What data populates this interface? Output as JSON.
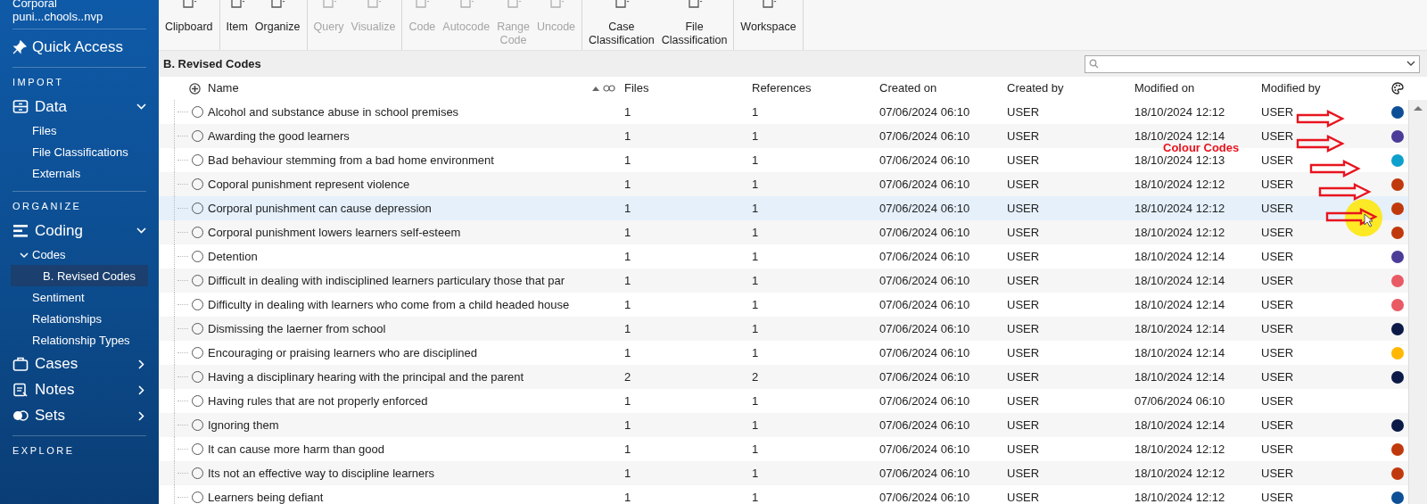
{
  "sidebar": {
    "project": [
      "Corporal",
      "puni...chools..nvp"
    ],
    "quick_access": "Quick Access",
    "sections": [
      {
        "heading": "IMPORT",
        "groups": [
          {
            "label": "Data",
            "expanded": true,
            "children": [
              {
                "label": "Files",
                "selected": false
              },
              {
                "label": "File Classifications",
                "selected": false
              },
              {
                "label": "Externals",
                "selected": false
              }
            ]
          }
        ]
      },
      {
        "heading": "ORGANIZE",
        "groups": [
          {
            "label": "Coding",
            "expanded": true,
            "children": [
              {
                "label": "Codes",
                "selected": false,
                "expanded": true,
                "children": [
                  {
                    "label": "B. Revised Codes",
                    "selected": true
                  }
                ]
              },
              {
                "label": "Sentiment",
                "selected": false
              },
              {
                "label": "Relationships",
                "selected": false
              },
              {
                "label": "Relationship Types",
                "selected": false
              }
            ]
          },
          {
            "label": "Cases",
            "expanded": false
          },
          {
            "label": "Notes",
            "expanded": false
          },
          {
            "label": "Sets",
            "expanded": false
          }
        ]
      },
      {
        "heading": "EXPLORE"
      }
    ]
  },
  "toolbar": [
    [
      {
        "label": "Clipboard",
        "disabled": false
      }
    ],
    [
      {
        "label": "Item",
        "disabled": false
      },
      {
        "label": "Organize",
        "disabled": false
      }
    ],
    [
      {
        "label": "Query",
        "disabled": true
      },
      {
        "label": "Visualize",
        "disabled": true
      }
    ],
    [
      {
        "label": "Code",
        "disabled": true
      },
      {
        "label": "Autocode",
        "disabled": true
      },
      {
        "label": "Range Code",
        "disabled": true
      },
      {
        "label": "Uncode",
        "disabled": true
      }
    ],
    [
      {
        "label": "Case Classification",
        "disabled": false
      },
      {
        "label": "File Classification",
        "disabled": false
      }
    ],
    [
      {
        "label": "Workspace",
        "disabled": false
      }
    ]
  ],
  "list_title": "B. Revised Codes",
  "table": {
    "columns": [
      {
        "label": "Name",
        "sorted": true
      },
      {
        "label": "Files"
      },
      {
        "label": "References"
      },
      {
        "label": "Created on"
      },
      {
        "label": "Created by"
      },
      {
        "label": "Modified on"
      },
      {
        "label": "Modified by"
      }
    ],
    "rows": [
      {
        "name": "Alcohol and substance abuse in school premises",
        "files": "1",
        "references": "1",
        "created_on": "07/06/2024 06:10",
        "created_by": "USER",
        "modified_on": "18/10/2024 12:12",
        "modified_by": "USER",
        "color": "#0d4f96",
        "selected": false
      },
      {
        "name": "Awarding the good learners",
        "files": "1",
        "references": "1",
        "created_on": "07/06/2024 06:10",
        "created_by": "USER",
        "modified_on": "18/10/2024 12:14",
        "modified_by": "USER",
        "color": "#4b3c98",
        "selected": false
      },
      {
        "name": "Bad behaviour stemming from a bad home environment",
        "files": "1",
        "references": "1",
        "created_on": "07/06/2024 06:10",
        "created_by": "USER",
        "modified_on": "18/10/2024 12:13",
        "modified_by": "USER",
        "color": "#0ea0cc",
        "selected": false
      },
      {
        "name": "Coporal punishment represent violence",
        "files": "1",
        "references": "1",
        "created_on": "07/06/2024 06:10",
        "created_by": "USER",
        "modified_on": "18/10/2024 12:12",
        "modified_by": "USER",
        "color": "#c0390c",
        "selected": false
      },
      {
        "name": "Corporal punishment can cause depression",
        "files": "1",
        "references": "1",
        "created_on": "07/06/2024 06:10",
        "created_by": "USER",
        "modified_on": "18/10/2024 12:12",
        "modified_by": "USER",
        "color": "#c0390c",
        "selected": true
      },
      {
        "name": "Corporal punishment lowers learners self-esteem",
        "files": "1",
        "references": "1",
        "created_on": "07/06/2024 06:10",
        "created_by": "USER",
        "modified_on": "18/10/2024 12:12",
        "modified_by": "USER",
        "color": "#c0390c",
        "selected": false
      },
      {
        "name": "Detention",
        "files": "1",
        "references": "1",
        "created_on": "07/06/2024 06:10",
        "created_by": "USER",
        "modified_on": "18/10/2024 12:14",
        "modified_by": "USER",
        "color": "#4b3c98",
        "selected": false
      },
      {
        "name": "Difficult in dealing with indisciplined learners particulary those that par",
        "files": "1",
        "references": "1",
        "created_on": "07/06/2024 06:10",
        "created_by": "USER",
        "modified_on": "18/10/2024 12:14",
        "modified_by": "USER",
        "color": "#e85a64",
        "selected": false
      },
      {
        "name": "Difficulty in dealing with learners who come from a child headed house",
        "files": "1",
        "references": "1",
        "created_on": "07/06/2024 06:10",
        "created_by": "USER",
        "modified_on": "18/10/2024 12:14",
        "modified_by": "USER",
        "color": "#e85a64",
        "selected": false
      },
      {
        "name": "Dismissing the laerner from school",
        "files": "1",
        "references": "1",
        "created_on": "07/06/2024 06:10",
        "created_by": "USER",
        "modified_on": "18/10/2024 12:14",
        "modified_by": "USER",
        "color": "#0b1a46",
        "selected": false
      },
      {
        "name": "Encouraging or praising learners who are disciplined",
        "files": "1",
        "references": "1",
        "created_on": "07/06/2024 06:10",
        "created_by": "USER",
        "modified_on": "18/10/2024 12:14",
        "modified_by": "USER",
        "color": "#ffb703",
        "selected": false
      },
      {
        "name": "Having a disciplinary hearing with the principal and the parent",
        "files": "2",
        "references": "2",
        "created_on": "07/06/2024 06:10",
        "created_by": "USER",
        "modified_on": "18/10/2024 12:14",
        "modified_by": "USER",
        "color": "#0b1a46",
        "selected": false
      },
      {
        "name": "Having rules that are not properly enforced",
        "files": "1",
        "references": "1",
        "created_on": "07/06/2024 06:10",
        "created_by": "USER",
        "modified_on": "07/06/2024 06:10",
        "modified_by": "USER",
        "selected": false
      },
      {
        "name": "Ignoring them",
        "files": "1",
        "references": "1",
        "created_on": "07/06/2024 06:10",
        "created_by": "USER",
        "modified_on": "18/10/2024 12:14",
        "modified_by": "USER",
        "color": "#0b1a46",
        "selected": false
      },
      {
        "name": "It can cause more harm than good",
        "files": "1",
        "references": "1",
        "created_on": "07/06/2024 06:10",
        "created_by": "USER",
        "modified_on": "18/10/2024 12:12",
        "modified_by": "USER",
        "color": "#c0390c",
        "selected": false
      },
      {
        "name": "Its not an effective way to discipline learners",
        "files": "1",
        "references": "1",
        "created_on": "07/06/2024 06:10",
        "created_by": "USER",
        "modified_on": "18/10/2024 12:12",
        "modified_by": "USER",
        "color": "#c0390c",
        "selected": false
      },
      {
        "name": "Learners being defiant",
        "files": "1",
        "references": "1",
        "created_on": "07/06/2024 06:10",
        "created_by": "USER",
        "modified_on": "18/10/2024 12:12",
        "modified_by": "USER",
        "color": "#0d4f96",
        "selected": false
      }
    ]
  },
  "annotation": {
    "label": "Colour Codes"
  }
}
